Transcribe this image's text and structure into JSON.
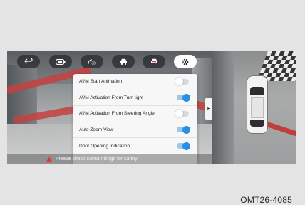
{
  "toolbar": {
    "buttons": [
      {
        "icon": "back-arrow-icon"
      },
      {
        "icon": "battery-icon"
      },
      {
        "icon": "steering-sensor-icon"
      },
      {
        "icon": "car-front-icon"
      },
      {
        "icon": "car-rear-icon"
      },
      {
        "icon": "gear-icon",
        "active": true
      }
    ]
  },
  "side_tab": {
    "label": "F"
  },
  "settings": {
    "items": [
      {
        "label": "AVM Start Animation",
        "on": false
      },
      {
        "label": "AVM Activation From Turn light",
        "on": true
      },
      {
        "label": "AVM Activation From Steering Angle",
        "on": false
      },
      {
        "label": "Auto Zoom View",
        "on": true
      },
      {
        "label": "Door Opening Indication",
        "on": true
      }
    ]
  },
  "warning": {
    "text": "Please check surroundings for safety"
  },
  "caption": "OMT26-4085",
  "colors": {
    "toggle_on": "#2a8ee2",
    "toggle_track_on": "#9ec7ea",
    "warning_icon": "#e23a3a"
  }
}
